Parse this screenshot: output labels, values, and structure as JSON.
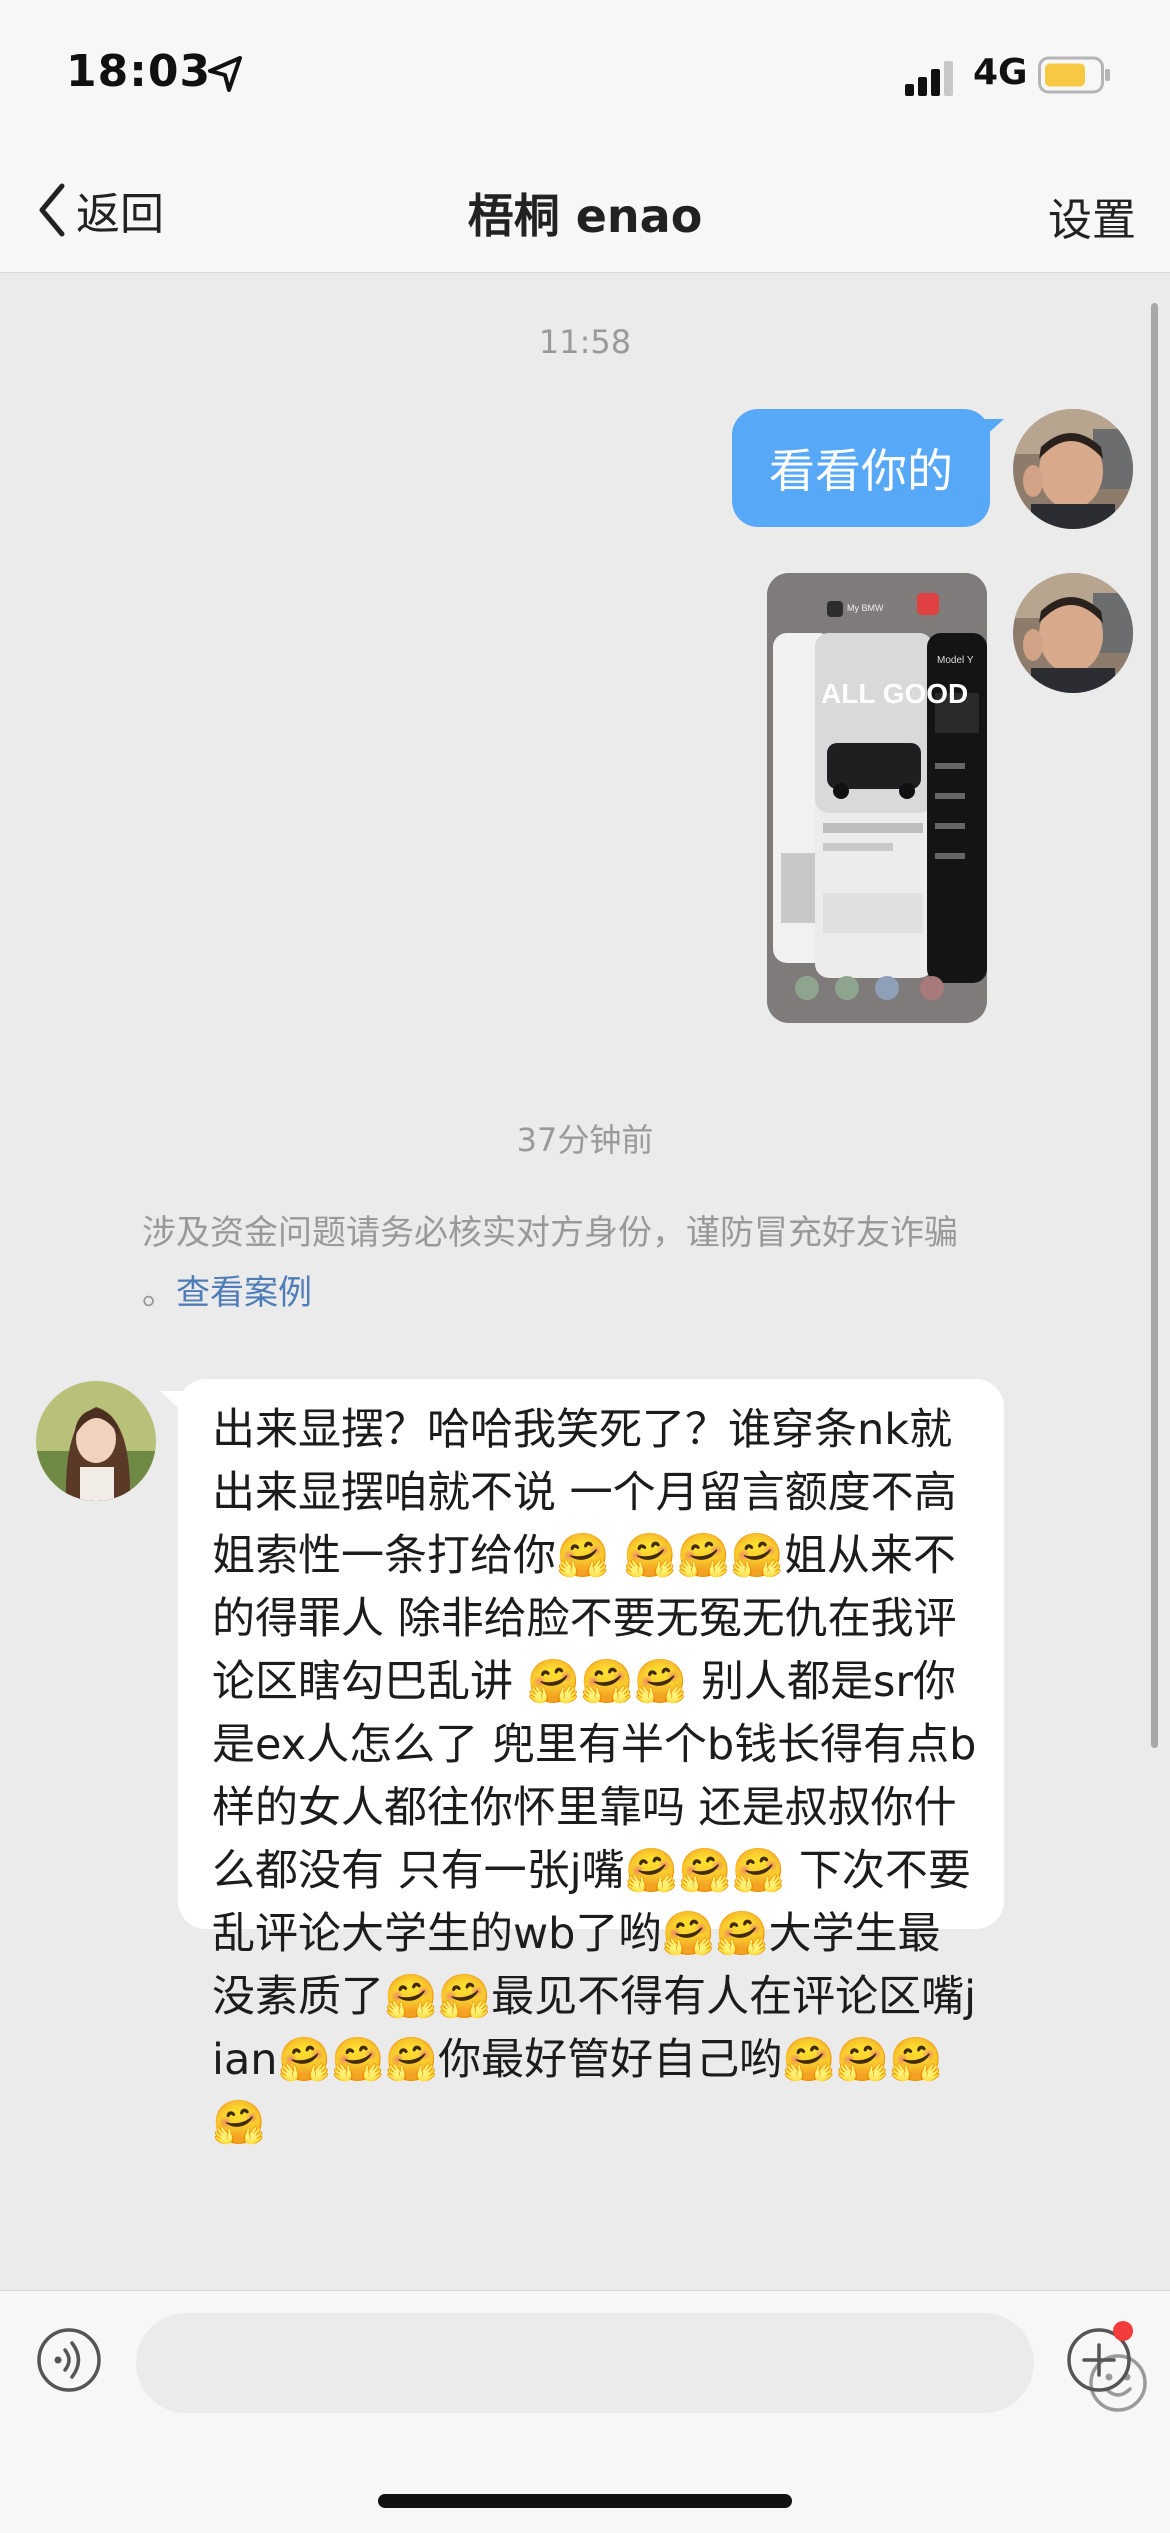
{
  "status_bar": {
    "time": "18:03",
    "network": "4G",
    "battery_color": "#f7c842",
    "icons": [
      "location-arrow-icon",
      "signal-icon",
      "battery-icon"
    ]
  },
  "nav": {
    "back_label": "返回",
    "title": "梧桐 enao",
    "settings_label": "设置"
  },
  "chat": {
    "timestamp_1": "11:58",
    "outgoing_text": "看看你的",
    "timestamp_2": "37分钟前",
    "warning_text": "涉及资金问题请务必核实对方身份，谨防冒充好友诈骗",
    "warning_prefix": "。",
    "warning_link": "查看案例",
    "screenshot": {
      "app_label_1": "My BMW",
      "headline": "ALL GOOD",
      "model_label": "Model Y"
    },
    "incoming_text": "出来显摆？哈哈我笑死了？谁穿条nk就出来显摆咱就不说 一个月留言额度不高 姐索性一条打给你🤗 🤗🤗🤗姐从来不的得罪人 除非给脸不要无冤无仇在我评论区瞎勾巴乱讲 🤗🤗🤗 别人都是sr你是ex人怎么了 兜里有半个b钱长得有点b样的女人都往你怀里靠吗 还是叔叔你什么都没有 只有一张j嘴🤗🤗🤗 下次不要乱评论大学生的wb了哟🤗🤗大学生最没素质了🤗🤗最见不得有人在评论区嘴jian🤗🤗🤗你最好管好自己哟🤗🤗🤗🤗"
  },
  "colors": {
    "outgoing_bubble": "#58a8f8",
    "link": "#4e7db8",
    "badge": "#f23b3b"
  }
}
